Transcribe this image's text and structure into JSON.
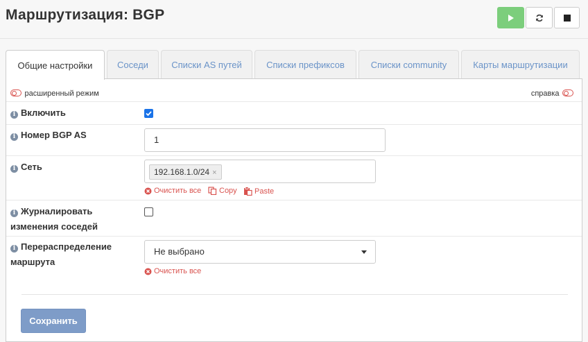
{
  "page": {
    "title": "Маршрутизация: BGP"
  },
  "service_buttons": {
    "play": "play-icon",
    "reload": "refresh-icon",
    "stop": "stop-icon",
    "play_color": "#7cce7c"
  },
  "tabs": [
    {
      "label": "Общие настройки",
      "active": true
    },
    {
      "label": "Соседи"
    },
    {
      "label": "Списки AS путей"
    },
    {
      "label": "Списки префиксов"
    },
    {
      "label": "Списки community"
    },
    {
      "label": "Карты маршрутизации"
    }
  ],
  "panel": {
    "advanced_mode_label": "расширенный режим",
    "help_label": "справка"
  },
  "fields": {
    "enable": {
      "label": "Включить",
      "checked": true
    },
    "as_number": {
      "label": "Номер BGP AS",
      "value": "1"
    },
    "network": {
      "label": "Сеть",
      "tags": [
        "192.168.1.0/24"
      ],
      "clear_all": "Очистить все",
      "copy": "Copy",
      "paste": "Paste"
    },
    "log_neighbor_changes": {
      "label_line1": "Журналировать",
      "label_line2": "изменения соседей",
      "checked": false
    },
    "redistribution": {
      "label_line1": "Перераспределение",
      "label_line2": "маршрута",
      "selected": "Не выбрано",
      "clear_all": "Очистить все"
    }
  },
  "save_label": "Сохранить",
  "colors": {
    "accent": "#6a93c8",
    "danger": "#d9534f",
    "save": "#7e9cc8",
    "checkbox": "#1a73e8"
  }
}
